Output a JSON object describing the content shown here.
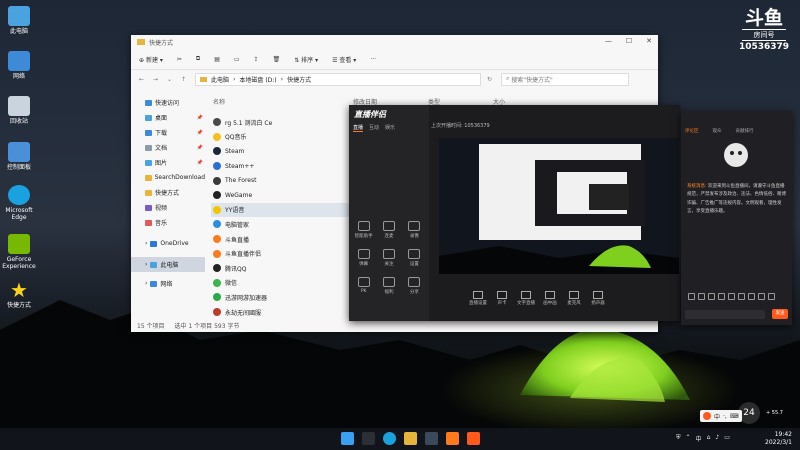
{
  "desktop": {
    "icons": [
      {
        "label": "此电脑",
        "color": "#4aa3df"
      },
      {
        "label": "网络",
        "color": "#3d8ad6"
      },
      {
        "label": "回收站",
        "color": "#c9d4df"
      },
      {
        "label": "控制面板",
        "color": "#4a90d9"
      },
      {
        "label": "Microsoft Edge",
        "color": "#1aa1e0"
      },
      {
        "label": "GeForce Experience",
        "color": "#76b900"
      },
      {
        "label": "快捷方式",
        "color": "#ffd21a"
      }
    ]
  },
  "watermark": {
    "logo": "斗鱼",
    "sub": "房间号",
    "room": "10536379"
  },
  "explorer": {
    "title": "快捷方式",
    "toolbar": {
      "new": "新建",
      "sort": "排序",
      "view": "查看",
      "more": "···"
    },
    "address": {
      "segments": [
        "此电脑",
        "本地磁盘 (D:)",
        "快捷方式"
      ],
      "search_placeholder": "搜索\"快捷方式\""
    },
    "columns": {
      "name": "名称",
      "date": "修改日期",
      "type": "类型",
      "size": "大小"
    },
    "sidebar": [
      {
        "label": "快速访问",
        "color": "#3d8ad6",
        "pin": ""
      },
      {
        "label": "桌面",
        "color": "#4aa3df",
        "pin": "📌"
      },
      {
        "label": "下载",
        "color": "#3d8ad6",
        "pin": "📌"
      },
      {
        "label": "文档",
        "color": "#8a9aa8",
        "pin": "📌"
      },
      {
        "label": "图片",
        "color": "#4aa3df",
        "pin": "📌"
      },
      {
        "label": "SearchDownload",
        "color": "#e7b43c",
        "pin": ""
      },
      {
        "label": "快捷方式",
        "color": "#e7b43c",
        "pin": ""
      },
      {
        "label": "视频",
        "color": "#7a5cc9",
        "pin": ""
      },
      {
        "label": "音乐",
        "color": "#e05a5a",
        "pin": ""
      },
      {
        "label": "OneDrive",
        "color": "#2a7ad6",
        "pin": ""
      },
      {
        "label": "此电脑",
        "color": "#4aa3df",
        "pin": ""
      },
      {
        "label": "网络",
        "color": "#3d8ad6",
        "pin": ""
      }
    ],
    "files": [
      {
        "name": "rg 5.1 测流白 Ce",
        "color": "#4a4a4a"
      },
      {
        "name": "QQ音乐",
        "color": "#f2c21a"
      },
      {
        "name": "Steam",
        "color": "#1b2838"
      },
      {
        "name": "Steam++",
        "color": "#2a6fd6"
      },
      {
        "name": "The Forest",
        "color": "#3a3a3a"
      },
      {
        "name": "WeGame",
        "color": "#222222"
      },
      {
        "name": "YY语音",
        "color": "#f5c400"
      },
      {
        "name": "电脑管家",
        "color": "#2a8fe0"
      },
      {
        "name": "斗鱼直播",
        "color": "#ff7a1a"
      },
      {
        "name": "斗鱼直播伴侣",
        "color": "#ff7a1a"
      },
      {
        "name": "腾讯QQ",
        "color": "#222222"
      },
      {
        "name": "微信",
        "color": "#3ab54a"
      },
      {
        "name": "迅游网游加速器",
        "color": "#2aa84a"
      },
      {
        "name": "永劫无间國服",
        "color": "#c0392b"
      }
    ],
    "status": {
      "count": "15 个项目",
      "selected": "选中 1 个项目 593 字节"
    }
  },
  "live": {
    "logo": "直播伴侣",
    "tabs": [
      "直播",
      "互动",
      "娱乐"
    ],
    "header": "上次开播时间: 10536379",
    "tools": [
      "智能助手",
      "连麦",
      "录像",
      "弹幕",
      "关注",
      "设置",
      "PK",
      "福利",
      "分享"
    ],
    "bottom": [
      "直播设置",
      "声卡",
      "文字直播",
      "画中画",
      "麦克风",
      "扬声器"
    ]
  },
  "chat": {
    "tabs": [
      "评论区",
      "观众",
      "贡献排行"
    ],
    "messages": [
      {
        "user": "系统消息:",
        "text": "欢迎来到斗鱼直播间，请遵守斗鱼直播规范，严禁发布涉及政治、违法、色情低俗、赌博诈骗、广告推广等违规内容。文明观看，理性发言，享受直播乐趣。"
      }
    ],
    "send": "发送"
  },
  "taskbar": {
    "apps": [
      {
        "name": "windows-start",
        "color": "#3aa0f0"
      },
      {
        "name": "search",
        "color": "#2a2f38"
      },
      {
        "name": "edge",
        "color": "#1aa1e0"
      },
      {
        "name": "explorer",
        "color": "#e7b43c"
      },
      {
        "name": "steam",
        "color": "#3a4a5a"
      },
      {
        "name": "douyu",
        "color": "#ff7a1a"
      },
      {
        "name": "douyu-companion",
        "color": "#ff5a1a"
      }
    ],
    "time": "19:42",
    "date": "2022/3/1",
    "ime": "中",
    "temp": "24",
    "weather": "+ 55.7"
  }
}
